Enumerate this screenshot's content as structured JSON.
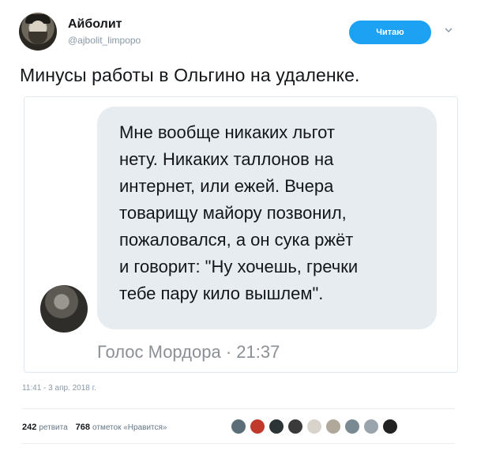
{
  "author": {
    "name": "Айболит",
    "handle": "@ajbolit_limpopo",
    "avatar_icon": "avatar-bearded-man"
  },
  "follow_button": {
    "label": "Читаю",
    "color": "#1da1f2"
  },
  "more_menu_icon": "chevron-down-icon",
  "tweet": {
    "text": "Минусы работы в Ольгино на удаленке."
  },
  "quote": {
    "message": "Мне вообще никаких льгот\nнету. Никаких таллонов на\nинтернет, или ежей. Вчера\nтоварищу майору позвонил,\nпожаловался, а он сука ржёт\nи говорит: \"Ну хочешь, гречки\nтебе пару кило вышлем\".",
    "sender_line": "Голос Мордора · 21:37",
    "bubble_color": "#e6ecf0"
  },
  "timestamp": "11:41 - 3 апр. 2018 г.",
  "stats": {
    "retweets_count": "242",
    "retweets_label": "ретвита",
    "likes_count": "768",
    "likes_label": "отметок «Нравится»"
  },
  "liker_avatar_colors": [
    "#5b6e78",
    "#c0392b",
    "#2d3436",
    "#3a3a3a",
    "#d8d4cc",
    "#b0a89a",
    "#7a8a92",
    "#9aa4ad",
    "#222222"
  ]
}
